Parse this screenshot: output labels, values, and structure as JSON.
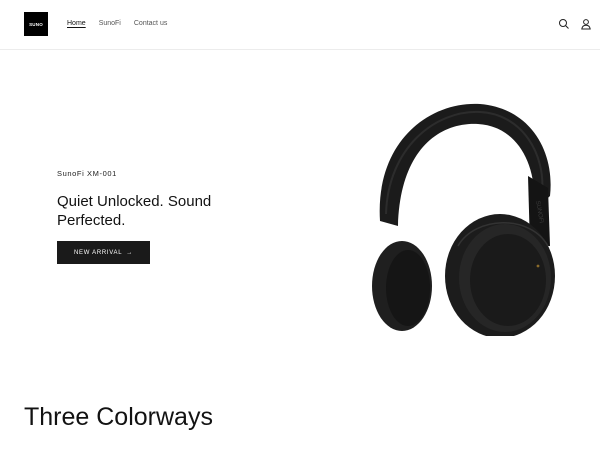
{
  "header": {
    "logo_text": "SUNO",
    "nav": [
      {
        "label": "Home",
        "active": true
      },
      {
        "label": "SunoFi",
        "active": false
      },
      {
        "label": "Contact us",
        "active": false
      }
    ],
    "icons": [
      "search-icon",
      "account-icon"
    ]
  },
  "hero": {
    "eyebrow": "SunoFi XM-001",
    "headline": "Quiet Unlocked. Sound Perfected.",
    "cta_label": "NEW ARRIVAL",
    "cta_arrow": "→",
    "image_brand_text": "SUNOFI"
  },
  "section": {
    "title": "Three Colorways"
  },
  "colors": {
    "text": "#121212",
    "button_bg": "#1a1a1a",
    "background": "#ffffff"
  }
}
